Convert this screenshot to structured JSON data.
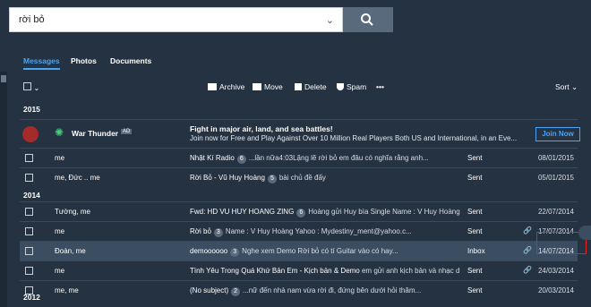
{
  "search": {
    "query": "rời bỏ",
    "clear": "⌄"
  },
  "tabs": [
    {
      "label": "Messages",
      "active": true
    },
    {
      "label": "Photos",
      "active": false
    },
    {
      "label": "Documents",
      "active": false
    }
  ],
  "toolbar": {
    "archive": "Archive",
    "move": "Move",
    "delete": "Delete",
    "spam": "Spam",
    "more": "•••",
    "sort": "Sort"
  },
  "sections": [
    "2015",
    "2014",
    "2012"
  ],
  "ad": {
    "name": "War Thunder",
    "tag": "AD",
    "headline": "Fight in major air, land, and sea battles!",
    "body": "Join now for Free and Play Against Over 10 Million Real Players Both US and International, in an Eve...",
    "button": "Join Now"
  },
  "rows": [
    {
      "from": "me",
      "subj": "Nhật Kí Radio",
      "count": "6",
      "snip": "...lần nữa4:03Lặng lẽ rời bỏ em đâu có nghĩa rằng anh...",
      "folder": "Sent",
      "clip": false,
      "date": "08/01/2015"
    },
    {
      "from": "me, Đức .. me",
      "subj": "Rời Bỏ - Vũ Huy Hoàng",
      "count": "5",
      "snip": "bài chủ đề đấy",
      "folder": "Sent",
      "clip": false,
      "date": "05/01/2015"
    },
    {
      "from": "Tường, me",
      "subj": "Fwd: HD VU HUY HOANG ZING",
      "count": "6",
      "snip": "Hoàng gửi Huy bìa Single Name : V Huy Hoàng",
      "folder": "Sent",
      "clip": false,
      "date": "22/07/2014"
    },
    {
      "from": "me",
      "subj": "Rời bỏ",
      "count": "3",
      "snip": "Name : V Huy Hoàng Yahoo : Mydestiny_ment@yahoo.c...",
      "folder": "Sent",
      "clip": true,
      "date": "17/07/2014"
    },
    {
      "from": "Đoàn, me",
      "subj": "demoooooo",
      "count": "3",
      "snip": "Nghe xem Demo Rời bỏ có tí Guitar vào có hay...",
      "folder": "Inbox",
      "clip": true,
      "date": "14/07/2014"
    },
    {
      "from": "me",
      "subj": "Tình Yêu Trong Quá Khứ Bản Em - Kịch bản & Demo",
      "count": "",
      "snip": "em gửi anh kịch bản và nhạc d",
      "folder": "Sent",
      "clip": true,
      "date": "24/03/2014"
    },
    {
      "from": "me, me",
      "subj": "(No subject)",
      "count": "2",
      "snip": "...nữ đến nhà nam vừa rời đi, đứng bên dưới hỏi thăm...",
      "folder": "Sent",
      "clip": false,
      "date": "20/03/2014"
    }
  ],
  "colors": {
    "background": "#253241",
    "accent": "#4aa3f5",
    "highlight_box": "#e02424"
  }
}
